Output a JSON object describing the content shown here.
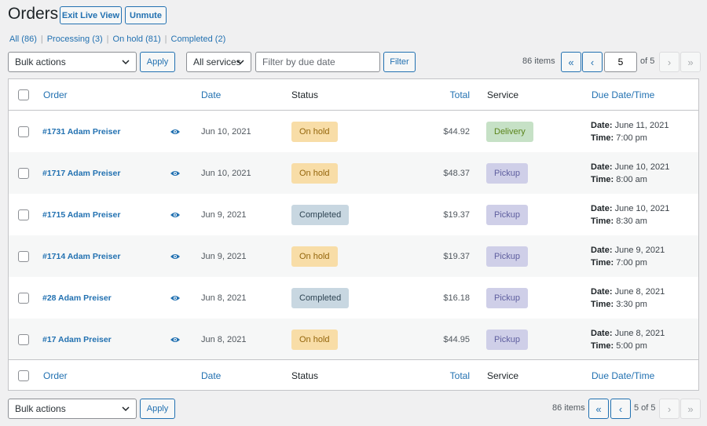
{
  "header": {
    "title": "Orders",
    "exit_live_view": "Exit Live View",
    "unmute": "Unmute"
  },
  "filters": [
    {
      "label": "All",
      "count": "(86)"
    },
    {
      "label": "Processing",
      "count": "(3)"
    },
    {
      "label": "On hold",
      "count": "(81)"
    },
    {
      "label": "Completed",
      "count": "(2)"
    }
  ],
  "toolbar_top": {
    "bulk_actions": "Bulk actions",
    "apply": "Apply",
    "services": "All services",
    "due_date_placeholder": "Filter by due date",
    "filter": "Filter",
    "items": "86 items",
    "first": "«",
    "prev": "‹",
    "current_page": "5",
    "of_pages": "of 5",
    "next": "›",
    "last": "»"
  },
  "toolbar_bottom": {
    "bulk_actions": "Bulk actions",
    "apply": "Apply",
    "items": "86 items",
    "first": "«",
    "prev": "‹",
    "page_label": "5 of 5",
    "next": "›",
    "last": "»"
  },
  "columns": {
    "order": "Order",
    "date": "Date",
    "status": "Status",
    "total": "Total",
    "service": "Service",
    "due": "Due Date/Time"
  },
  "status_colors": {
    "On hold": {
      "bg": "#f8dda7",
      "fg": "#94660c"
    },
    "Completed": {
      "bg": "#c8d7e1",
      "fg": "#2e4453"
    }
  },
  "service_colors": {
    "Delivery": {
      "bg": "#c6e1c6",
      "fg": "#5b841b"
    },
    "Pickup": {
      "bg": "#cfcfe8",
      "fg": "#5f5f9f"
    }
  },
  "orders": [
    {
      "order": "#1731 Adam Preiser",
      "date": "Jun 10, 2021",
      "status": "On hold",
      "total": "$44.92",
      "service": "Delivery",
      "due_date": "June 11, 2021",
      "due_time": "7:00 pm"
    },
    {
      "order": "#1717 Adam Preiser",
      "date": "Jun 10, 2021",
      "status": "On hold",
      "total": "$48.37",
      "service": "Pickup",
      "due_date": "June 10, 2021",
      "due_time": "8:00 am"
    },
    {
      "order": "#1715 Adam Preiser",
      "date": "Jun 9, 2021",
      "status": "Completed",
      "total": "$19.37",
      "service": "Pickup",
      "due_date": "June 10, 2021",
      "due_time": "8:30 am"
    },
    {
      "order": "#1714 Adam Preiser",
      "date": "Jun 9, 2021",
      "status": "On hold",
      "total": "$19.37",
      "service": "Pickup",
      "due_date": "June 9, 2021",
      "due_time": "7:00 pm"
    },
    {
      "order": "#28 Adam Preiser",
      "date": "Jun 8, 2021",
      "status": "Completed",
      "total": "$16.18",
      "service": "Pickup",
      "due_date": "June 8, 2021",
      "due_time": "3:30 pm"
    },
    {
      "order": "#17 Adam Preiser",
      "date": "Jun 8, 2021",
      "status": "On hold",
      "total": "$44.95",
      "service": "Pickup",
      "due_date": "June 8, 2021",
      "due_time": "5:00 pm"
    }
  ],
  "labels": {
    "due_date": "Date:",
    "due_time": "Time:"
  }
}
